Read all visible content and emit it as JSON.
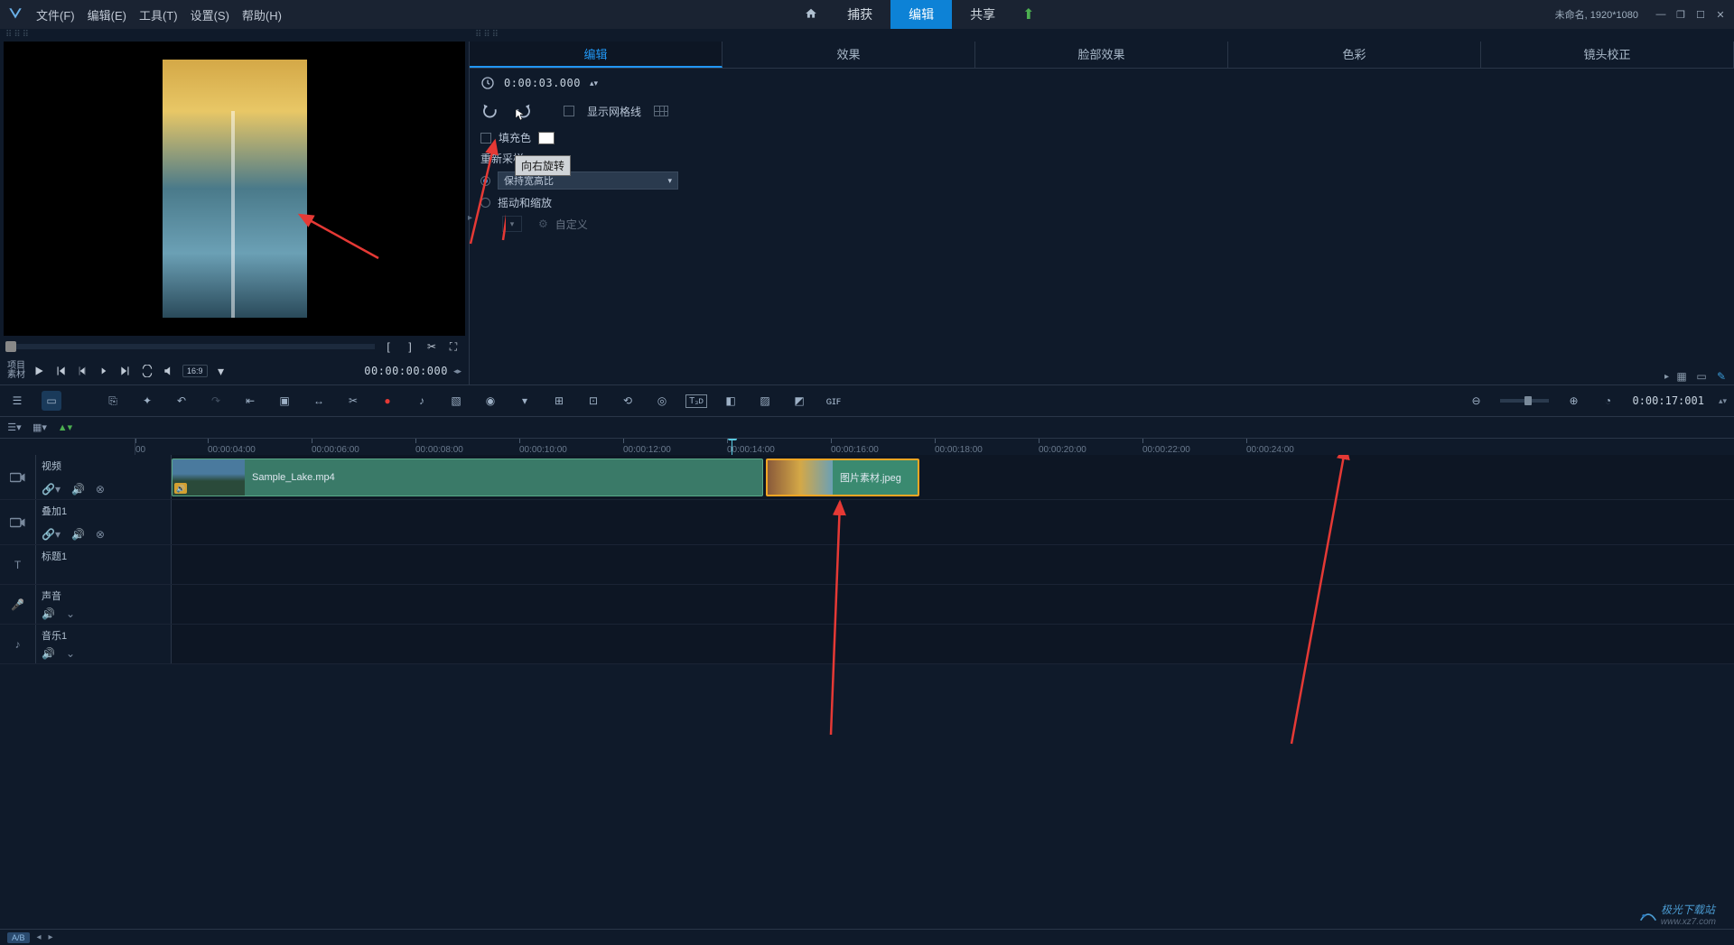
{
  "menubar": {
    "file": "文件(F)",
    "edit": "编辑(E)",
    "tools": "工具(T)",
    "settings": "设置(S)",
    "help": "帮助(H)"
  },
  "modes": {
    "capture": "捕获",
    "edit": "编辑",
    "share": "共享"
  },
  "title_status": "未命名, 1920*1080",
  "preview": {
    "project_label": "项目",
    "material_label": "素材",
    "timecode": "00:00:00:000",
    "aspect": "16:9"
  },
  "option_tabs": {
    "edit": "编辑",
    "effects": "效果",
    "face_effects": "脸部效果",
    "color": "色彩",
    "lens": "镜头校正"
  },
  "options": {
    "duration": "0:00:03.000",
    "tooltip": "向右旋转",
    "fill_color": "填充色",
    "show_grid": "显示网格线",
    "resample_label": "重新采样",
    "keep_aspect": "保持宽高比",
    "pan_zoom": "摇动和缩放",
    "custom": "自定义"
  },
  "ruler_times": [
    "00",
    "00:00:04:00",
    "00:00:06:00",
    "00:00:08:00",
    "00:00:10:00",
    "00:00:12:00",
    "00:00:14:00",
    "00:00:16:00",
    "00:00:18:00",
    "00:00:20:00",
    "00:00:22:00",
    "00:00:24:00"
  ],
  "toolbar_time": "0:00:17:001",
  "tracks": {
    "video": "视频",
    "overlay": "叠加1",
    "title": "标题1",
    "sound": "声音",
    "music": "音乐1"
  },
  "clips": {
    "video1": "Sample_Lake.mp4",
    "image1": "图片素材.jpeg"
  },
  "bottombar_tag": "A/B",
  "watermark": {
    "text": "极光下载站",
    "url": "www.xz7.com"
  }
}
